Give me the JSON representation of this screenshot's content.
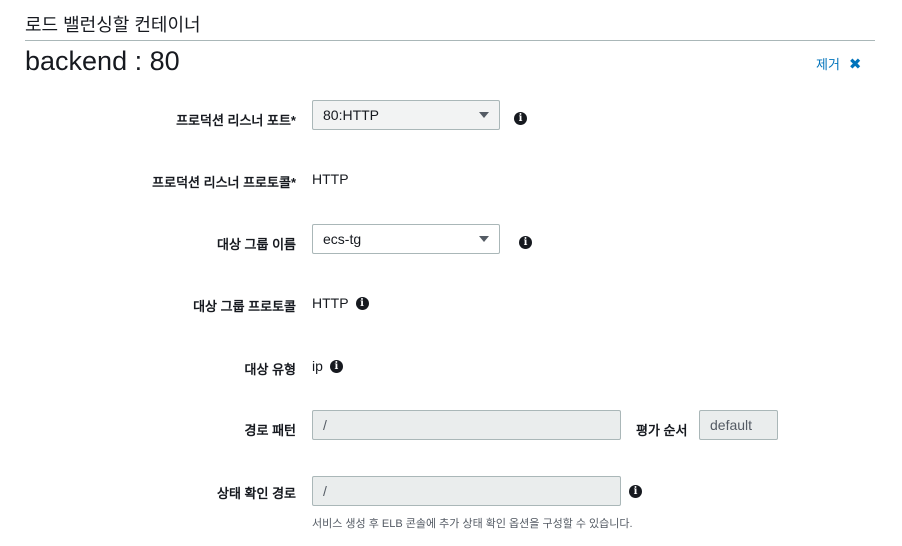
{
  "section": {
    "title": "로드 밸런싱할 컨테이너"
  },
  "container": {
    "name": "backend : 80",
    "remove_label": "제거",
    "remove_icon": "close-icon"
  },
  "fields": {
    "listener_port": {
      "label": "프로덕션 리스너 포트*",
      "value": "80:HTTP"
    },
    "listener_protocol": {
      "label": "프로덕션 리스너 프로토콜*",
      "value": "HTTP"
    },
    "target_group_name": {
      "label": "대상 그룹 이름",
      "value": "ecs-tg"
    },
    "target_group_protocol": {
      "label": "대상 그룹 프로토콜",
      "value": "HTTP"
    },
    "target_type": {
      "label": "대상 유형",
      "value": "ip"
    },
    "path_pattern": {
      "label": "경로 패턴",
      "value": "/"
    },
    "evaluation_order": {
      "label": "평가 순서",
      "value": "default"
    },
    "health_check_path": {
      "label": "상태 확인 경로",
      "value": "/",
      "hint": "서비스 생성 후 ELB 콘솔에 추가 상태 확인 옵션을 구성할 수 있습니다."
    }
  },
  "icons": {
    "info": "info-icon",
    "info_glyph": "i"
  },
  "colors": {
    "link": "#0073bb",
    "border": "#aab7b8",
    "disabled_bg": "#eaeded"
  }
}
